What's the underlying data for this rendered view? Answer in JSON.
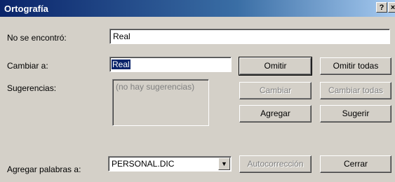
{
  "window": {
    "title": "Ortografía",
    "help_button": "?",
    "close_button": "×"
  },
  "not_found": {
    "label": "No se encontró:",
    "value": "Real"
  },
  "change_to": {
    "label": "Cambiar a:",
    "value": "Real"
  },
  "suggestions": {
    "label": "Sugerencias:",
    "empty_text": "(no hay sugerencias)"
  },
  "add_words": {
    "label": "Agregar palabras a:",
    "selected": "PERSONAL.DIC",
    "arrow_icon": "triangle-down-icon"
  },
  "buttons": {
    "omitir": "Omitir",
    "omitir_todas": "Omitir todas",
    "cambiar": "Cambiar",
    "cambiar_todas": "Cambiar todas",
    "agregar": "Agregar",
    "sugerir": "Sugerir",
    "autocorreccion": "Autocorrección",
    "cerrar": "Cerrar"
  }
}
